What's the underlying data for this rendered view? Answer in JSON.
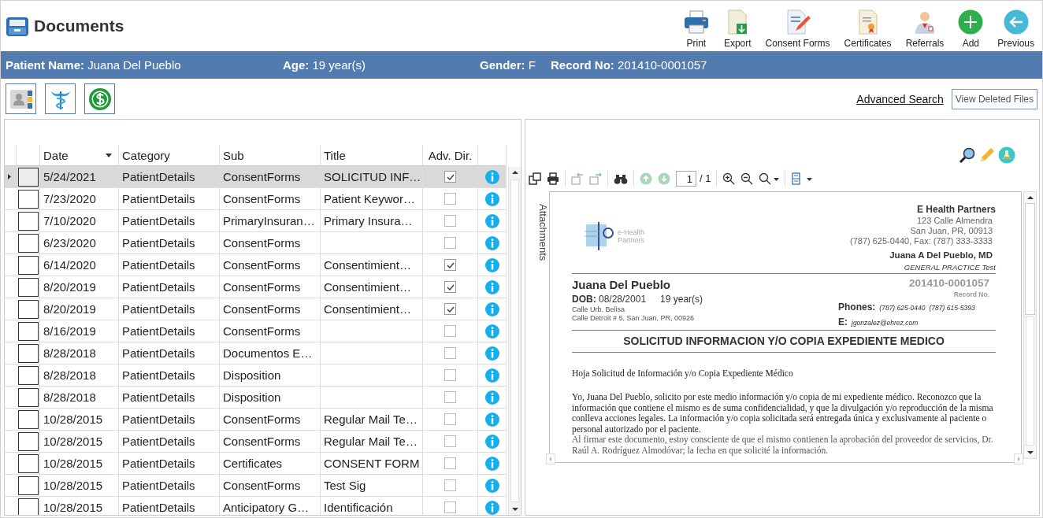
{
  "header": {
    "title": "Documents"
  },
  "toolbar": [
    {
      "label": "Print",
      "kind": "print"
    },
    {
      "label": "Export",
      "kind": "export"
    },
    {
      "label": "Consent Forms",
      "kind": "consent"
    },
    {
      "label": "Certificates",
      "kind": "certificate"
    },
    {
      "label": "Referrals",
      "kind": "referral"
    },
    {
      "label": "Add",
      "kind": "add"
    },
    {
      "label": "Previous",
      "kind": "previous"
    }
  ],
  "patient_bar": [
    {
      "label": "Patient Name:",
      "value": "Juana Del Pueblo"
    },
    {
      "label": "Age:",
      "value": "19 year(s)"
    },
    {
      "label": "Gender:",
      "value": "F"
    },
    {
      "label": "Record No:",
      "value": "201410-0001057"
    }
  ],
  "quick_buttons": [
    {
      "kind": "contacts"
    },
    {
      "kind": "medical"
    },
    {
      "kind": "billing"
    }
  ],
  "advanced_search": "Advanced Search",
  "view_deleted": "View Deleted Files",
  "grid": {
    "columns": [
      {
        "label": "Date",
        "sorted": true
      },
      {
        "label": "Category",
        "sorted": false
      },
      {
        "label": "Sub",
        "sorted": false
      },
      {
        "label": "Title",
        "sorted": false
      },
      {
        "label": "Adv. Dir.",
        "sorted": false
      }
    ],
    "rows": [
      {
        "date": "5/24/2021",
        "category": "PatientDetails",
        "sub": "ConsentForms",
        "title": "SOLICITUD INF…",
        "checked": true,
        "selected": true
      },
      {
        "date": "7/23/2020",
        "category": "PatientDetails",
        "sub": "ConsentForms",
        "title": "Patient Keywor…",
        "checked": false,
        "selected": false
      },
      {
        "date": "7/10/2020",
        "category": "PatientDetails",
        "sub": "PrimaryInsuran…",
        "title": "Primary Insura…",
        "checked": false,
        "selected": false
      },
      {
        "date": "6/23/2020",
        "category": "PatientDetails",
        "sub": "ConsentForms",
        "checked": false,
        "selected": false
      },
      {
        "date": "6/14/2020",
        "category": "PatientDetails",
        "sub": "ConsentForms",
        "title": "Consentimient…",
        "checked": true,
        "selected": false
      },
      {
        "date": "8/20/2019",
        "category": "PatientDetails",
        "sub": "ConsentForms",
        "title": "Consentimient…",
        "checked": true,
        "selected": false
      },
      {
        "date": "8/20/2019",
        "category": "PatientDetails",
        "sub": "ConsentForms",
        "title": "Consentimient…",
        "checked": true,
        "selected": false
      },
      {
        "date": "8/16/2019",
        "category": "PatientDetails",
        "sub": "ConsentForms",
        "checked": false,
        "selected": false
      },
      {
        "date": "8/28/2018",
        "category": "PatientDetails",
        "sub": "Documentos E…",
        "checked": false,
        "selected": false
      },
      {
        "date": "8/28/2018",
        "category": "PatientDetails",
        "sub": "Disposition",
        "checked": false,
        "selected": false
      },
      {
        "date": "8/28/2018",
        "category": "PatientDetails",
        "sub": "Disposition",
        "checked": false,
        "selected": false
      },
      {
        "date": "10/28/2015",
        "category": "PatientDetails",
        "sub": "ConsentForms",
        "title": "Regular Mail Te…",
        "checked": false,
        "selected": false
      },
      {
        "date": "10/28/2015",
        "category": "PatientDetails",
        "sub": "ConsentForms",
        "title": "Regular Mail Te…",
        "checked": false,
        "selected": false
      },
      {
        "date": "10/28/2015",
        "category": "PatientDetails",
        "sub": "Certificates",
        "title": "CONSENT FORM",
        "checked": false,
        "selected": false
      },
      {
        "date": "10/28/2015",
        "category": "PatientDetails",
        "sub": "ConsentForms",
        "title": "Test Sig",
        "checked": false,
        "selected": false
      },
      {
        "date": "10/28/2015",
        "category": "PatientDetails",
        "sub": "Anticipatory G…",
        "title": "Identificación",
        "checked": false,
        "selected": false
      }
    ]
  },
  "viewer": {
    "side_tab": "Attachments",
    "page_input": "1",
    "page_total": "/ 1",
    "document": {
      "logo_lines": [
        "e-Health",
        "Partners"
      ],
      "org": "E Health Partners",
      "org_address": [
        "123 Calle Almendra",
        "San Juan, PR, 00913",
        "(787) 625-0440, Fax: (787) 333-3333"
      ],
      "doctor": "Juana A Del Pueblo, MD",
      "specialty": "GENERAL PRACTICE Test",
      "patient_name": "Juana Del Pueblo",
      "dob_label": "DOB:",
      "dob": "08/28/2001",
      "age": "19 year(s)",
      "patient_address": [
        "Calle Urb. Belisa",
        "Calle Detroit # 5, San Juan, PR, 00926"
      ],
      "record": "201410-0001057",
      "record_label": "Record No.",
      "phones_label": "Phones:",
      "phones": [
        "(787) 625-0440",
        "(787) 615-5393"
      ],
      "email_label": "E:",
      "email": "jgonzalez@ehrez.com",
      "heading": "SOLICITUD INFORMACION Y/O COPIA EXPEDIENTE MEDICO",
      "subtitle": "Hoja Solicitud de Información y/o Copia Expediente Médico",
      "paragraphs": [
        "Yo, Juana Del Pueblo, solicito por este medio información y/o copia de mi expediente médico. Reconozco que la información que contiene el mismo es de suma confidencialidad, y que la divulgación y/o reproducción de la misma conlleva acciones legales. La información y/o copia solicitada será entregada única y exclusivamente al paciente o personal autorizado por el paciente.",
        "Al firmar este documento, estoy consciente de que el mismo contienen la aprobación del proveedor de servicios, Dr. Raúl A. Rodríguez Almodóvar; la fecha en que solicité la información."
      ]
    }
  }
}
